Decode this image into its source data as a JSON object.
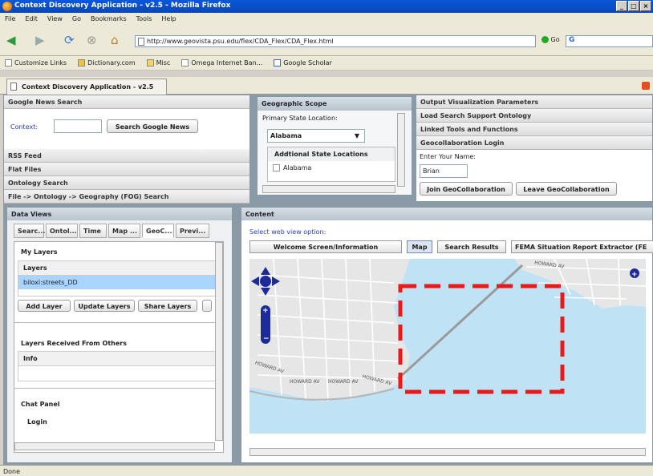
{
  "window": {
    "title": "Context Discovery Application - v2.5 - Mozilla Firefox",
    "controls": [
      "_",
      "□",
      "×"
    ]
  },
  "menu": [
    "File",
    "Edit",
    "View",
    "Go",
    "Bookmarks",
    "Tools",
    "Help"
  ],
  "nav": {
    "url": "http://www.geovista.psu.edu/flex/CDA_Flex/CDA_Flex.html",
    "go_label": "Go",
    "search_placeholder": ""
  },
  "bookmarks": [
    "Customize Links",
    "Dictionary.com",
    "Misc",
    "Omega Internet Ban...",
    "Google Scholar"
  ],
  "tab": {
    "title": "Context Discovery Application - v2.5"
  },
  "left_top": {
    "google_header": "Google News Search",
    "context_label": "Context:",
    "context_value": "",
    "search_button": "Search Google News",
    "sections": [
      "RSS Feed",
      "Flat Files",
      "Ontology Search",
      "File -> Ontology -> Geography (FOG) Search"
    ]
  },
  "geo_scope": {
    "header": "Geographic Scope",
    "primary_label": "Primary State Location:",
    "primary_value": "Alabama",
    "additional_header": "Addtional State Locations",
    "additional_items": [
      "Alabama"
    ]
  },
  "right_top": {
    "sections": [
      "Output Visualization Parameters",
      "Load Search Support Ontology",
      "Linked Tools and Functions",
      "Geocollaboration Login"
    ],
    "name_label": "Enter Your Name:",
    "name_value": "Brian",
    "join_button": "Join GeoCollaboration",
    "leave_button": "Leave GeoCollaboration"
  },
  "data_views": {
    "header": "Data Views",
    "tabs": [
      "Searc...",
      "Ontol...",
      "Time",
      "Map ...",
      "GeoC...",
      "Previ..."
    ],
    "my_layers": "My Layers",
    "layers_col": "Layers",
    "layer_selected": "biloxi:streets_DD",
    "add_layer": "Add Layer",
    "update_layers": "Update Layers",
    "share_layers": "Share Layers",
    "received_header": "Layers Received From Others",
    "info_col": "Info",
    "chat_header": "Chat Panel",
    "login_label": "Login"
  },
  "content": {
    "header": "Content",
    "select_label": "Select web view option:",
    "tabs": [
      "Welcome Screen/Information",
      "Map",
      "Search Results",
      "FEMA Situation Report Extractor (FE"
    ],
    "street_labels": [
      "HOWARD AV",
      "HOWARD AV",
      "HOWARD AV",
      "HOWARD AV",
      "HOWARD AV"
    ]
  },
  "status": {
    "text": "Done"
  },
  "colors": {
    "water": "#bfe3f5",
    "land": "#e6e6e6",
    "selection": "#a8d4ff",
    "highlight_box": "#e81a1a",
    "nav_control": "#1d2a9a"
  }
}
